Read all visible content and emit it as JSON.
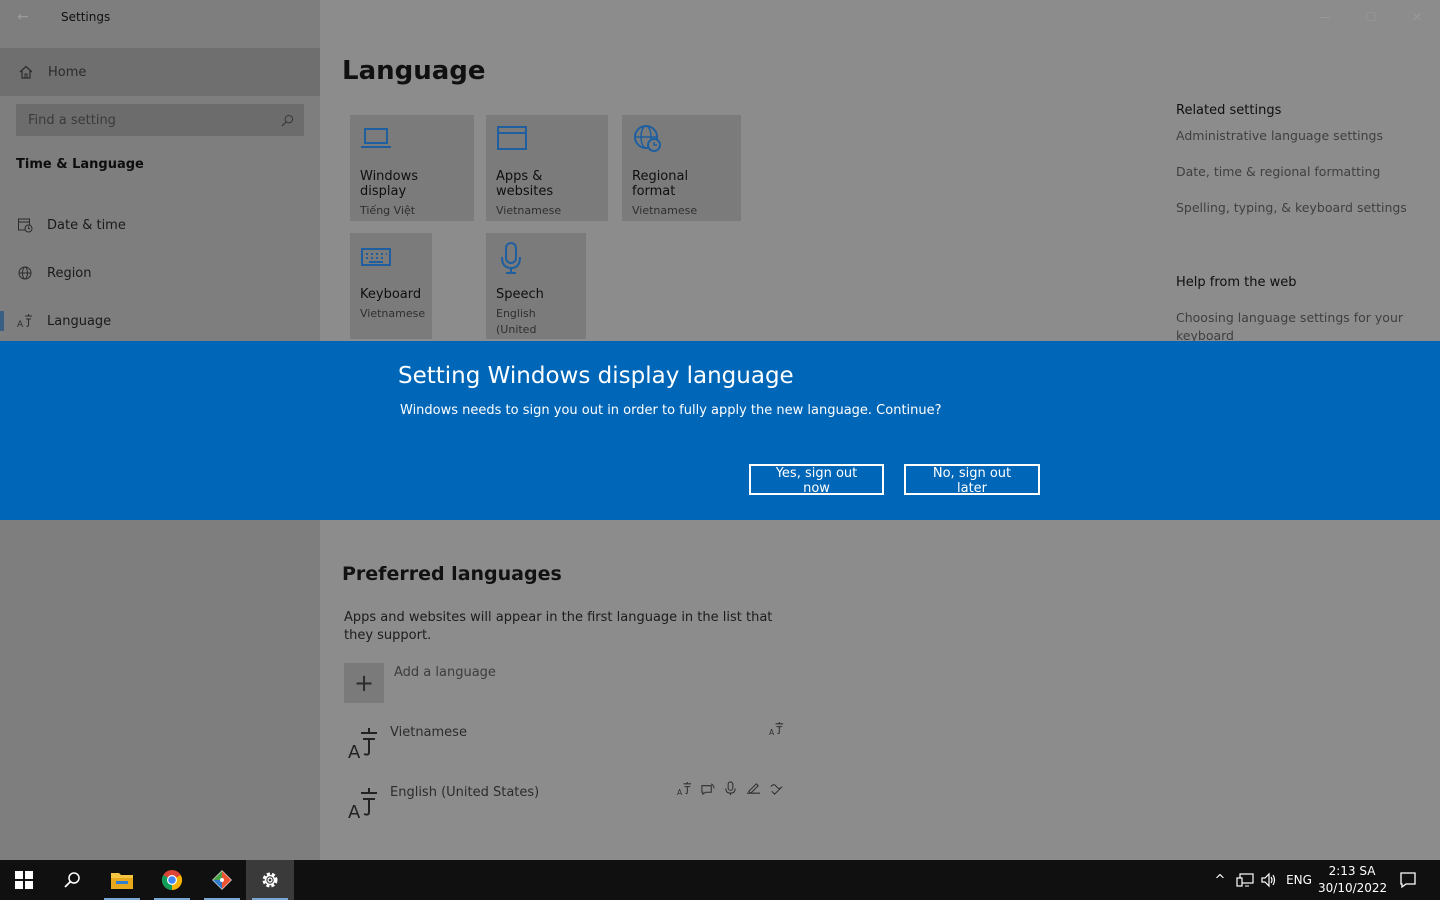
{
  "window": {
    "title": "Settings",
    "back_glyph": "←",
    "controls": [
      "—",
      "☐",
      "✕"
    ]
  },
  "sidebar": {
    "home_label": "Home",
    "search_placeholder": "Find a setting",
    "section_title": "Time & Language",
    "items": [
      {
        "label": "Date & time",
        "icon": "date-time-icon"
      },
      {
        "label": "Region",
        "icon": "globe-icon"
      },
      {
        "label": "Language",
        "icon": "language-icon",
        "active": true
      }
    ]
  },
  "main": {
    "title": "Language",
    "tiles": [
      {
        "name": "Windows display",
        "sub": "Tiếng Việt",
        "icon": "laptop-icon"
      },
      {
        "name": "Apps & websites",
        "sub": "Vietnamese",
        "icon": "window-icon"
      },
      {
        "name": "Regional format",
        "sub": "Vietnamese",
        "icon": "globe-clock-icon"
      },
      {
        "name": "Keyboard",
        "sub": "Vietnamese",
        "icon": "keyboard-icon"
      },
      {
        "name": "Speech",
        "sub": "English (United States)",
        "icon": "microphone-icon"
      }
    ],
    "related": {
      "title": "Related settings",
      "links": [
        "Administrative language settings",
        "Date, time & regional formatting",
        "Spelling, typing, & keyboard settings"
      ]
    },
    "help": {
      "title": "Help from the web",
      "links": [
        "Choosing language settings for your keyboard"
      ]
    },
    "preferred": {
      "title": "Preferred languages",
      "description": "Apps and websites will appear in the first language in the list that they support.",
      "add_label": "Add a language",
      "languages": [
        {
          "name": "Vietnamese",
          "features": [
            "display-language-icon"
          ]
        },
        {
          "name": "English (United States)",
          "features": [
            "display-language-icon",
            "text-to-speech-icon",
            "speech-recognition-icon",
            "handwriting-icon",
            "basic-typing-icon"
          ]
        }
      ]
    }
  },
  "dialog": {
    "title": "Setting Windows display language",
    "message": "Windows needs to sign you out in order to fully apply the new language. Continue?",
    "yes_label": "Yes, sign out now",
    "no_label": "No, sign out later"
  },
  "taskbar": {
    "apps": [
      "start-icon",
      "search-icon",
      "file-explorer-icon",
      "chrome-icon",
      "git-icon",
      "settings-icon"
    ],
    "tray": {
      "chevron": "^",
      "input_language": "ENG",
      "time": "2:13 SA",
      "date": "30/10/2022"
    }
  },
  "colors": {
    "dialog_bg": "#0067b8",
    "accent_icon": "#1f5f9f",
    "taskbar_bg": "#101010"
  }
}
